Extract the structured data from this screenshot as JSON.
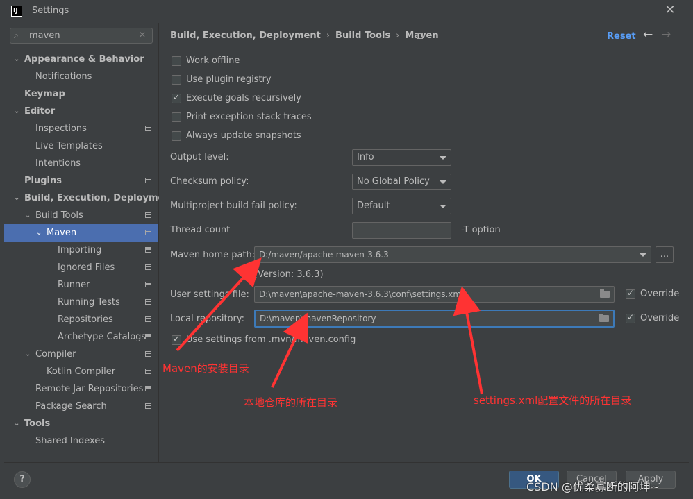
{
  "window": {
    "title": "Settings",
    "logo_text": "IJ"
  },
  "search": {
    "value": "maven"
  },
  "sidebar": {
    "items": [
      {
        "label": "Appearance & Behavior"
      },
      {
        "label": "Notifications"
      },
      {
        "label": "Keymap"
      },
      {
        "label": "Editor"
      },
      {
        "label": "Inspections"
      },
      {
        "label": "Live Templates"
      },
      {
        "label": "Intentions"
      },
      {
        "label": "Plugins"
      },
      {
        "label": "Build, Execution, Deployment"
      },
      {
        "label": "Build Tools"
      },
      {
        "label": "Maven"
      },
      {
        "label": "Importing"
      },
      {
        "label": "Ignored Files"
      },
      {
        "label": "Runner"
      },
      {
        "label": "Running Tests"
      },
      {
        "label": "Repositories"
      },
      {
        "label": "Archetype Catalogs"
      },
      {
        "label": "Compiler"
      },
      {
        "label": "Kotlin Compiler"
      },
      {
        "label": "Remote Jar Repositories"
      },
      {
        "label": "Package Search"
      },
      {
        "label": "Tools"
      },
      {
        "label": "Shared Indexes"
      }
    ]
  },
  "header": {
    "crumbs": [
      "Build, Execution, Deployment",
      "Build Tools",
      "Maven"
    ],
    "separator": "›",
    "reset_label": "Reset",
    "back_icon": "arrow-left-icon",
    "forward_icon": "arrow-right-icon"
  },
  "options": [
    {
      "label": "Work offline",
      "checked": false
    },
    {
      "label": "Use plugin registry",
      "checked": false
    },
    {
      "label": "Execute goals recursively",
      "checked": true
    },
    {
      "label": "Print exception stack traces",
      "checked": false
    },
    {
      "label": "Always update snapshots",
      "checked": false
    }
  ],
  "fields": {
    "output_level": {
      "label": "Output level:",
      "value": "Info"
    },
    "checksum_policy": {
      "label": "Checksum policy:",
      "value": "No Global Policy"
    },
    "fail_policy": {
      "label": "Multiproject build fail policy:",
      "value": "Default"
    },
    "thread_count": {
      "label": "Thread count",
      "value": "",
      "hint": "-T option"
    },
    "maven_home": {
      "label": "Maven home path:",
      "value": "D:/maven/apache-maven-3.6.3",
      "browse_label": "...",
      "version": "(Version: 3.6.3)"
    },
    "user_settings": {
      "label": "User settings file:",
      "value": "D:\\maven\\apache-maven-3.6.3\\conf\\settings.xml",
      "override_label": "Override",
      "override_checked": true
    },
    "local_repo": {
      "label": "Local repository:",
      "value": "D:\\maven\\mavenRepository",
      "override_label": "Override",
      "override_checked": true
    },
    "mvn_config": {
      "label": "Use settings from .mvn/maven.config",
      "checked": true
    }
  },
  "annotations": {
    "maven_home": "Maven的安装目录",
    "local_repo": "本地仓库的所在目录",
    "settings_xml": "settings.xml配置文件的所在目录",
    "color": "#ff3333"
  },
  "footer": {
    "help_label": "?",
    "ok_label": "OK",
    "cancel_label": "Cancel",
    "apply_label": "Apply",
    "watermark": "CSDN @优柔寡断的阿坤~"
  },
  "colors": {
    "selection": "#4b6eaf",
    "link": "#589df6",
    "background": "#3c3f41"
  }
}
